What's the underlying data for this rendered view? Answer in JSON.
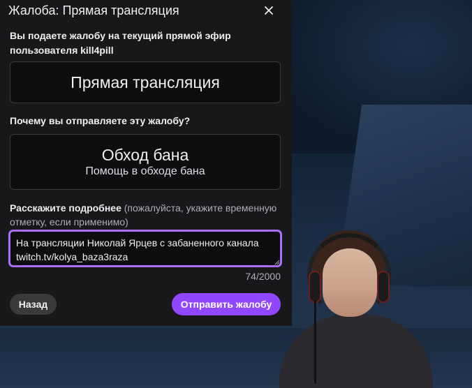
{
  "dialog": {
    "title": "Жалоба: Прямая трансляция",
    "close_icon": "close-icon"
  },
  "intro": {
    "line1": "Вы подаете жалобу на текущий прямой эфир",
    "line2_prefix": "пользователя ",
    "username": "kill4pill"
  },
  "category": {
    "title": "Прямая трансляция"
  },
  "reason": {
    "question": "Почему вы отправляете эту жалобу?",
    "title": "Обход бана",
    "subtitle": "Помощь в обходе бана"
  },
  "details": {
    "label_strong": "Расскажите подробнее",
    "label_hint": " (пожалуйста, укажите временную отметку, если применимо)",
    "value": "На трансляции Николай Ярцев с забаненного канала twitch.tv/kolya_baza3raza",
    "counter": "74/2000"
  },
  "buttons": {
    "back": "Назад",
    "submit": "Отправить жалобу"
  },
  "colors": {
    "dialog_bg": "#18181b",
    "input_focus": "#a970ff",
    "primary": "#9147ff",
    "secondary_btn": "#3a3a3d"
  }
}
